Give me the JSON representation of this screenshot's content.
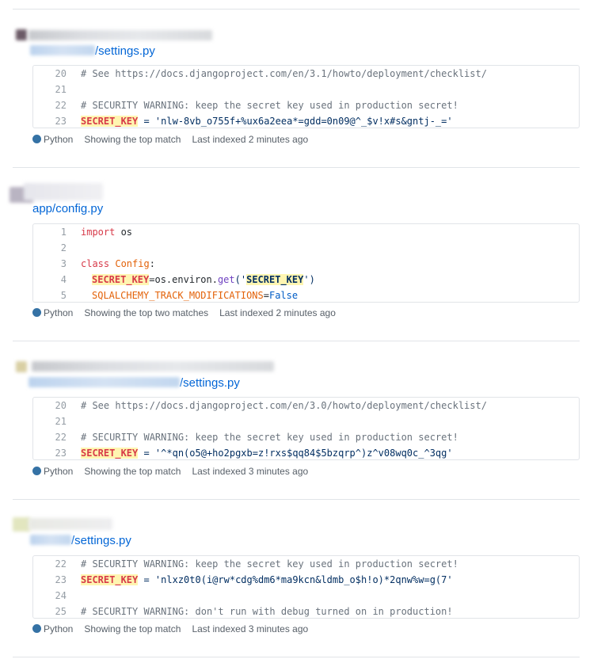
{
  "language": {
    "name": "Python",
    "color": "#3572A5"
  },
  "results": [
    {
      "path_suffix": "/settings.py",
      "lines": [
        {
          "num": "20",
          "text": "# See https://docs.djangoproject.com/en/3.1/howto/deployment/checklist/"
        },
        {
          "num": "21",
          "text": ""
        },
        {
          "num": "22",
          "text": "# SECURITY WARNING: keep the secret key used in production secret!"
        },
        {
          "num": "23",
          "key": "SECRET_KEY",
          "rest": " = 'nlw-8vb_o755f+%ux6a2eea*=gdd=0n09@^_$v!x#s&gntj-_='"
        }
      ],
      "match_text": "Showing the top match",
      "indexed_text": "Last indexed 2 minutes ago"
    },
    {
      "path": "app/config.py",
      "lines": [
        {
          "num": "1",
          "kw": "import",
          "rest": " os"
        },
        {
          "num": "2",
          "text": ""
        },
        {
          "num": "3",
          "kw": "class",
          "cls": "Config",
          "rest": ":"
        },
        {
          "num": "4",
          "key": "SECRET_KEY",
          "mid": "=os.environ.",
          "fn": "get",
          "open": "('",
          "key2": "SECRET_KEY",
          "close": "')"
        },
        {
          "num": "5",
          "attr": "SQLALCHEMY_TRACK_MODIFICATIONS",
          "eq": "=",
          "con": "False"
        }
      ],
      "match_text": "Showing the top two matches",
      "indexed_text": "Last indexed 2 minutes ago"
    },
    {
      "path_suffix": "/settings.py",
      "lines": [
        {
          "num": "20",
          "text": "# See https://docs.djangoproject.com/en/3.0/howto/deployment/checklist/"
        },
        {
          "num": "21",
          "text": ""
        },
        {
          "num": "22",
          "text": "# SECURITY WARNING: keep the secret key used in production secret!"
        },
        {
          "num": "23",
          "key": "SECRET_KEY",
          "rest": " = '^*qn(o5@+ho2pgxb=z!rxs$qq84$5bzqrp^)z^v08wq0c_^3qg'"
        }
      ],
      "match_text": "Showing the top match",
      "indexed_text": "Last indexed 3 minutes ago"
    },
    {
      "path_suffix": "/settings.py",
      "lines": [
        {
          "num": "22",
          "text": "# SECURITY WARNING: keep the secret key used in production secret!"
        },
        {
          "num": "23",
          "key": "SECRET_KEY",
          "rest": " = 'nlxz0t0(i@rw*cdg%dm6*ma9kcn&ldmb_o$h!o)*2qnw%w=g(7'"
        },
        {
          "num": "24",
          "text": ""
        },
        {
          "num": "25",
          "text": "# SECURITY WARNING: don't run with debug turned on in production!"
        }
      ],
      "match_text": "Showing the top match",
      "indexed_text": "Last indexed 3 minutes ago"
    }
  ]
}
